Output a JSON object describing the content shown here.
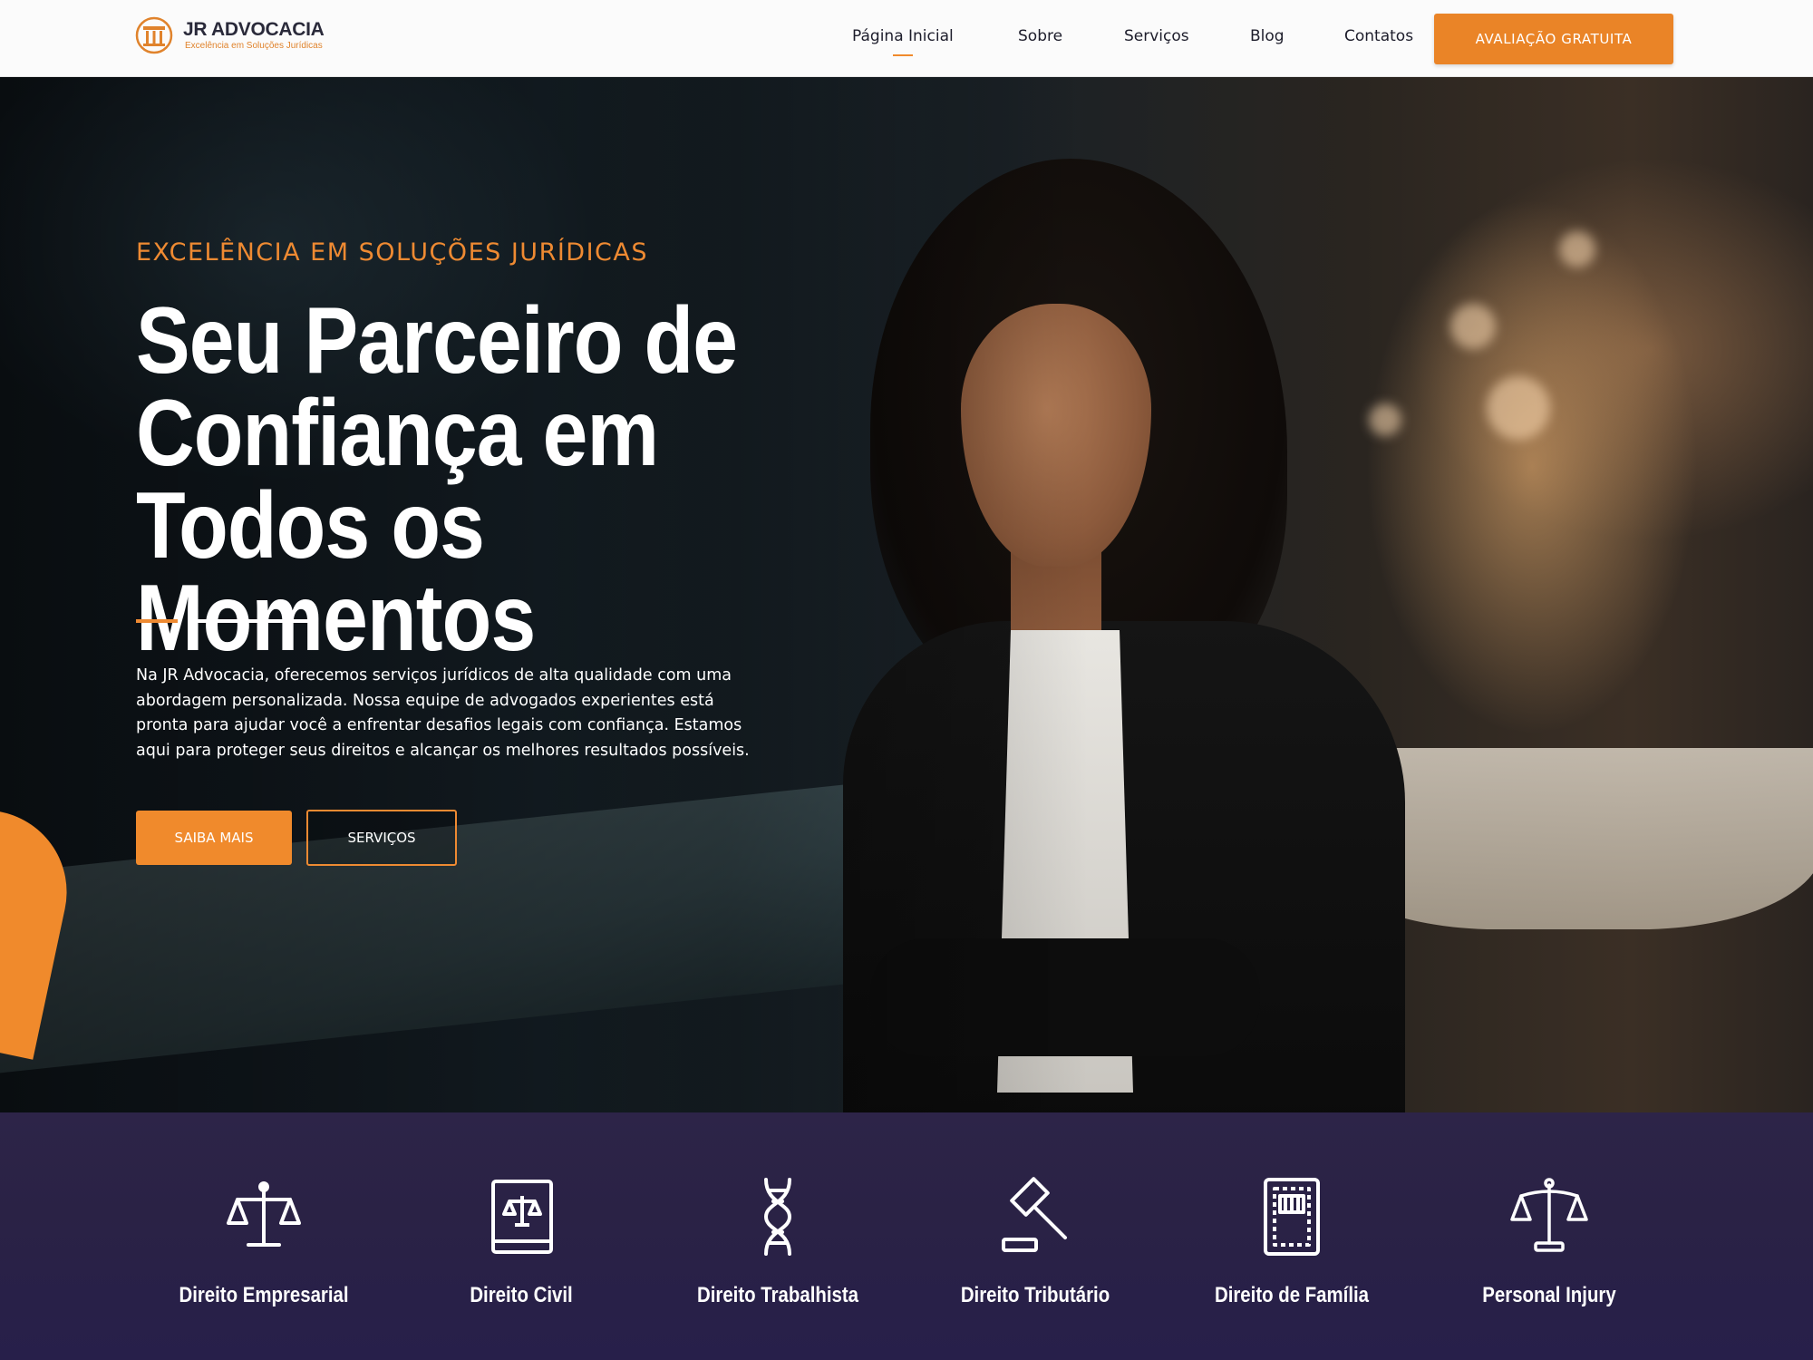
{
  "header": {
    "logo_title": "JR ADVOCACIA",
    "logo_tagline": "Excelência em Soluções Jurídicas",
    "nav": [
      {
        "label": "Página Inicial",
        "active": true
      },
      {
        "label": "Sobre",
        "active": false
      },
      {
        "label": "Serviços",
        "active": false
      },
      {
        "label": "Blog",
        "active": false
      },
      {
        "label": "Contatos",
        "active": false
      }
    ],
    "cta_label": "AVALIAÇÃO GRATUITA"
  },
  "hero": {
    "kicker": "EXCELÊNCIA EM SOLUÇÕES JURÍDICAS",
    "headline": "Seu Parceiro de Confiança em Todos os Momentos",
    "lead": "Na JR Advocacia, oferecemos serviços jurídicos de alta qualidade com uma abordagem personalizada. Nossa equipe de advogados experientes está pronta para ajudar você a enfrentar desafios legais com confiança. Estamos aqui para proteger seus direitos e alcançar os melhores resultados possíveis.",
    "primary_button": "SAIBA MAIS",
    "secondary_button": "SERVIÇOS"
  },
  "services": [
    {
      "label": "Direito Empresarial",
      "icon": "scales-icon"
    },
    {
      "label": "Direito Civil",
      "icon": "law-book-icon"
    },
    {
      "label": "Direito Trabalhista",
      "icon": "dna-icon"
    },
    {
      "label": "Direito Tributário",
      "icon": "gavel-icon"
    },
    {
      "label": "Direito de Família",
      "icon": "document-icon"
    },
    {
      "label": "Personal Injury",
      "icon": "balance-icon"
    }
  ],
  "colors": {
    "accent": "#EE8A2C",
    "services_bg": "#2A2245",
    "text_dark": "#1D1D2B"
  }
}
